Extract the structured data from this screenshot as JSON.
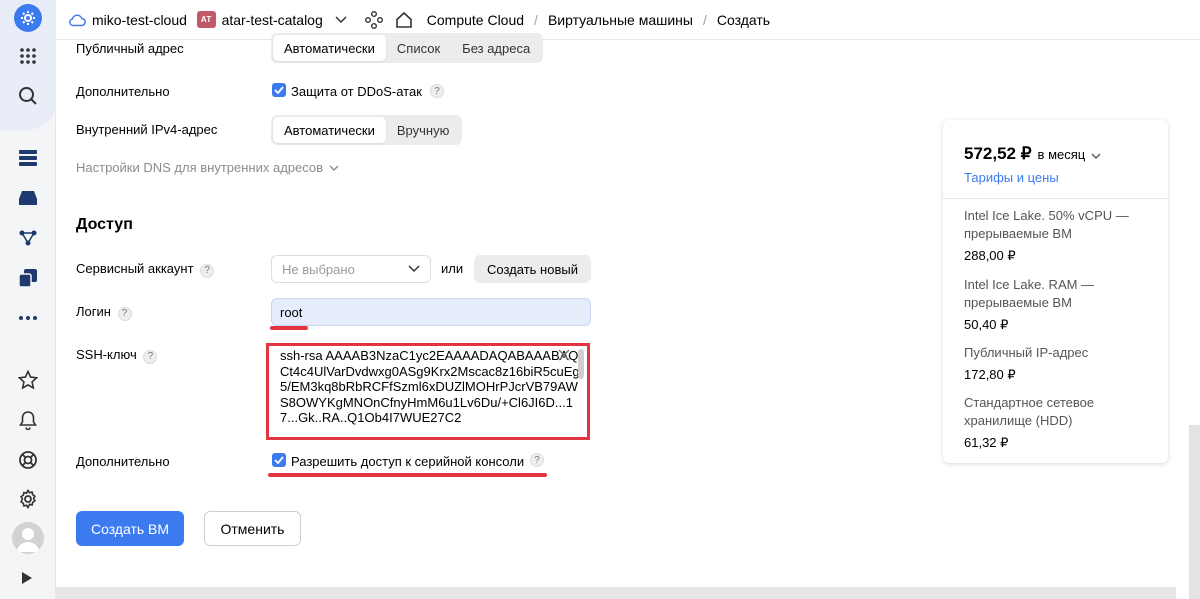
{
  "header": {
    "cloud": "miko-test-cloud",
    "folder_badge": "AT",
    "folder": "atar-test-catalog",
    "service": "Compute Cloud",
    "section": "Виртуальные машины",
    "page": "Создать"
  },
  "network": {
    "public_address_label": "Публичный адрес",
    "public_address_options": [
      "Автоматически",
      "Список",
      "Без адреса"
    ],
    "additional_label": "Дополнительно",
    "ddos_label": "Защита от DDoS-атак",
    "internal_ipv4_label": "Внутренний IPv4-адрес",
    "internal_ipv4_options": [
      "Автоматически",
      "Вручную"
    ],
    "dns_settings": "Настройки DNS для внутренних адресов"
  },
  "access": {
    "title": "Доступ",
    "service_account_label": "Сервисный аккаунт",
    "service_account_placeholder": "Не выбрано",
    "or_text": "или",
    "create_new_label": "Создать новый",
    "login_label": "Логин",
    "login_value": "root",
    "ssh_label": "SSH-ключ",
    "ssh_value": "ssh-rsa AAAAB3NzaC1yc2EAAAADAQABAAABAQCt4c4UlVarDvdwxg0ASg9Krx2Mscac8z16biR5cuEg5/EM3kq8bRbRCFfSzml6xDUZlMOHrPJcrVB79AWS8OWYKgMNOnCfnyHmM6u1Lv6Du/+Cl6JI6D...17...Gk..RA..Q1Ob4I7WUE27C2",
    "additional_label": "Дополнительно",
    "serial_console_label": "Разрешить доступ к серийной консоли"
  },
  "actions": {
    "create_label": "Создать ВМ",
    "cancel_label": "Отменить"
  },
  "price": {
    "amount": "572,52 ₽",
    "period": "в месяц",
    "tariffs_link": "Тарифы и цены",
    "items": [
      {
        "name": "Intel Ice Lake. 50% vCPU — прерываемые ВМ",
        "value": "288,00 ₽"
      },
      {
        "name": "Intel Ice Lake. RAM — прерываемые ВМ",
        "value": "50,40 ₽"
      },
      {
        "name": "Публичный IP-адрес",
        "value": "172,80 ₽"
      },
      {
        "name": "Стандартное сетевое хранилище (HDD)",
        "value": "61,32 ₽"
      }
    ]
  },
  "colors": {
    "accent": "#3c7af0",
    "highlight": "#e2353f"
  }
}
